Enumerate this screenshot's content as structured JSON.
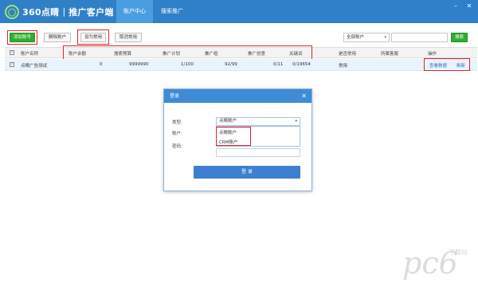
{
  "app": {
    "logo_brand": "360点睛",
    "logo_separator": "|",
    "logo_product": "推广客户端",
    "tabs": [
      "账户中心",
      "搜索推广"
    ]
  },
  "toolbar": {
    "add_account": "添加账号",
    "delete_account": "删除账户",
    "set_common": "设为常用",
    "cancel_common": "取消常用",
    "filter_value": "全部账户",
    "search_button": "搜索"
  },
  "table": {
    "headers": [
      "账户名称",
      "账户余额",
      "搜索预算",
      "推广计划",
      "推广组",
      "推广创意",
      "关键词",
      "是否常用",
      "所属客服",
      "操作"
    ],
    "rows": [
      {
        "name": "点睛广告测试",
        "balance": "0",
        "budget": "9999990",
        "plans": "1/100",
        "groups": "92/99",
        "creatives": "0/11",
        "keywords": "0/19654",
        "is_common": "常用",
        "service": "",
        "action_view": "查看数据",
        "action_refresh": "刷新"
      }
    ]
  },
  "dialog": {
    "title": "登录",
    "type_label": "类型:",
    "type_value": "点睛账户",
    "options": [
      "点睛账户",
      "CRM账户"
    ],
    "account_label": "账户:",
    "password_label": "密码:",
    "login_button": "登 录"
  },
  "watermark": {
    "text": "pc6",
    "sub": "下载站"
  },
  "colors": {
    "header_bg": "#2f7fc9",
    "active_tab": "#4a9ee0",
    "green_button": "#2eae2e",
    "highlight_box": "#d9282b",
    "row_selected": "#e9f3fc",
    "dialog_title": "#3f8bd6"
  }
}
